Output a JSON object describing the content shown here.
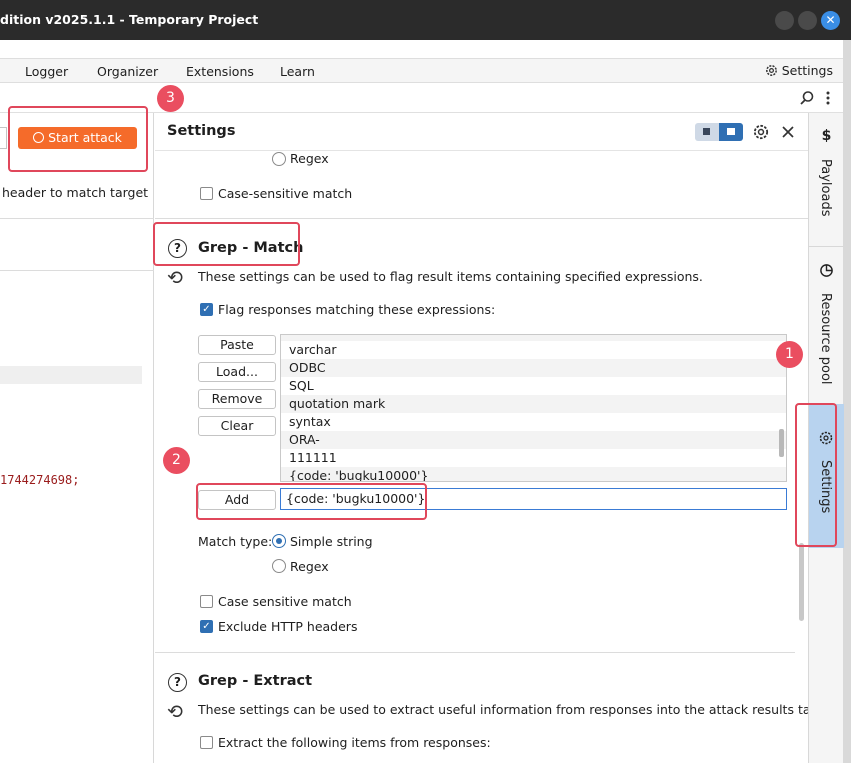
{
  "window": {
    "title": "dition v2025.1.1 - Temporary Project",
    "close_glyph": "✕"
  },
  "menubar": {
    "items": [
      "Logger",
      "Organizer",
      "Extensions",
      "Learn"
    ],
    "settings_label": "Settings"
  },
  "left": {
    "start_attack_label": "Start attack",
    "hint_text": "header to match target",
    "code_text": "1744274698;"
  },
  "settings_panel": {
    "title": "Settings",
    "regex_label_top": "Regex",
    "case_sensitive_match_top": "Case-sensitive match",
    "grep_match": {
      "title": "Grep - Match",
      "description": "These settings can be used to flag result items containing specified expressions.",
      "flag_label": "Flag responses matching these expressions:",
      "flag_checked": true,
      "buttons": {
        "paste": "Paste",
        "load": "Load...",
        "remove": "Remove",
        "clear": "Clear",
        "add": "Add"
      },
      "list_items": [
        "varchar",
        "ODBC",
        "SQL",
        "quotation mark",
        "syntax",
        "ORA-",
        "111111",
        "{code: 'bugku10000'}"
      ],
      "add_input_value": "{code: 'bugku10000'}",
      "match_type_label": "Match type:",
      "match_type_options": [
        "Simple string",
        "Regex"
      ],
      "match_type_selected": "Simple string",
      "case_sensitive_label": "Case sensitive match",
      "case_sensitive_checked": false,
      "exclude_headers_label": "Exclude HTTP headers",
      "exclude_headers_checked": true
    },
    "grep_extract": {
      "title": "Grep - Extract",
      "description": "These settings can be used to extract useful information from responses into the attack results table.",
      "extract_label": "Extract the following items from responses:",
      "extract_checked": false
    }
  },
  "sidebar": {
    "tabs": [
      {
        "label": "Payloads",
        "icon": "dollar-icon"
      },
      {
        "label": "Resource pool",
        "icon": "pie-chart-icon"
      },
      {
        "label": "Settings",
        "icon": "gear-icon",
        "active": true
      }
    ]
  },
  "annotations": {
    "badges": [
      "1",
      "2",
      "3"
    ],
    "color": "#e0475b"
  },
  "colors": {
    "accent_orange": "#f56b2a",
    "accent_blue": "#2f6fb3",
    "active_tab": "#b8d3ef"
  }
}
